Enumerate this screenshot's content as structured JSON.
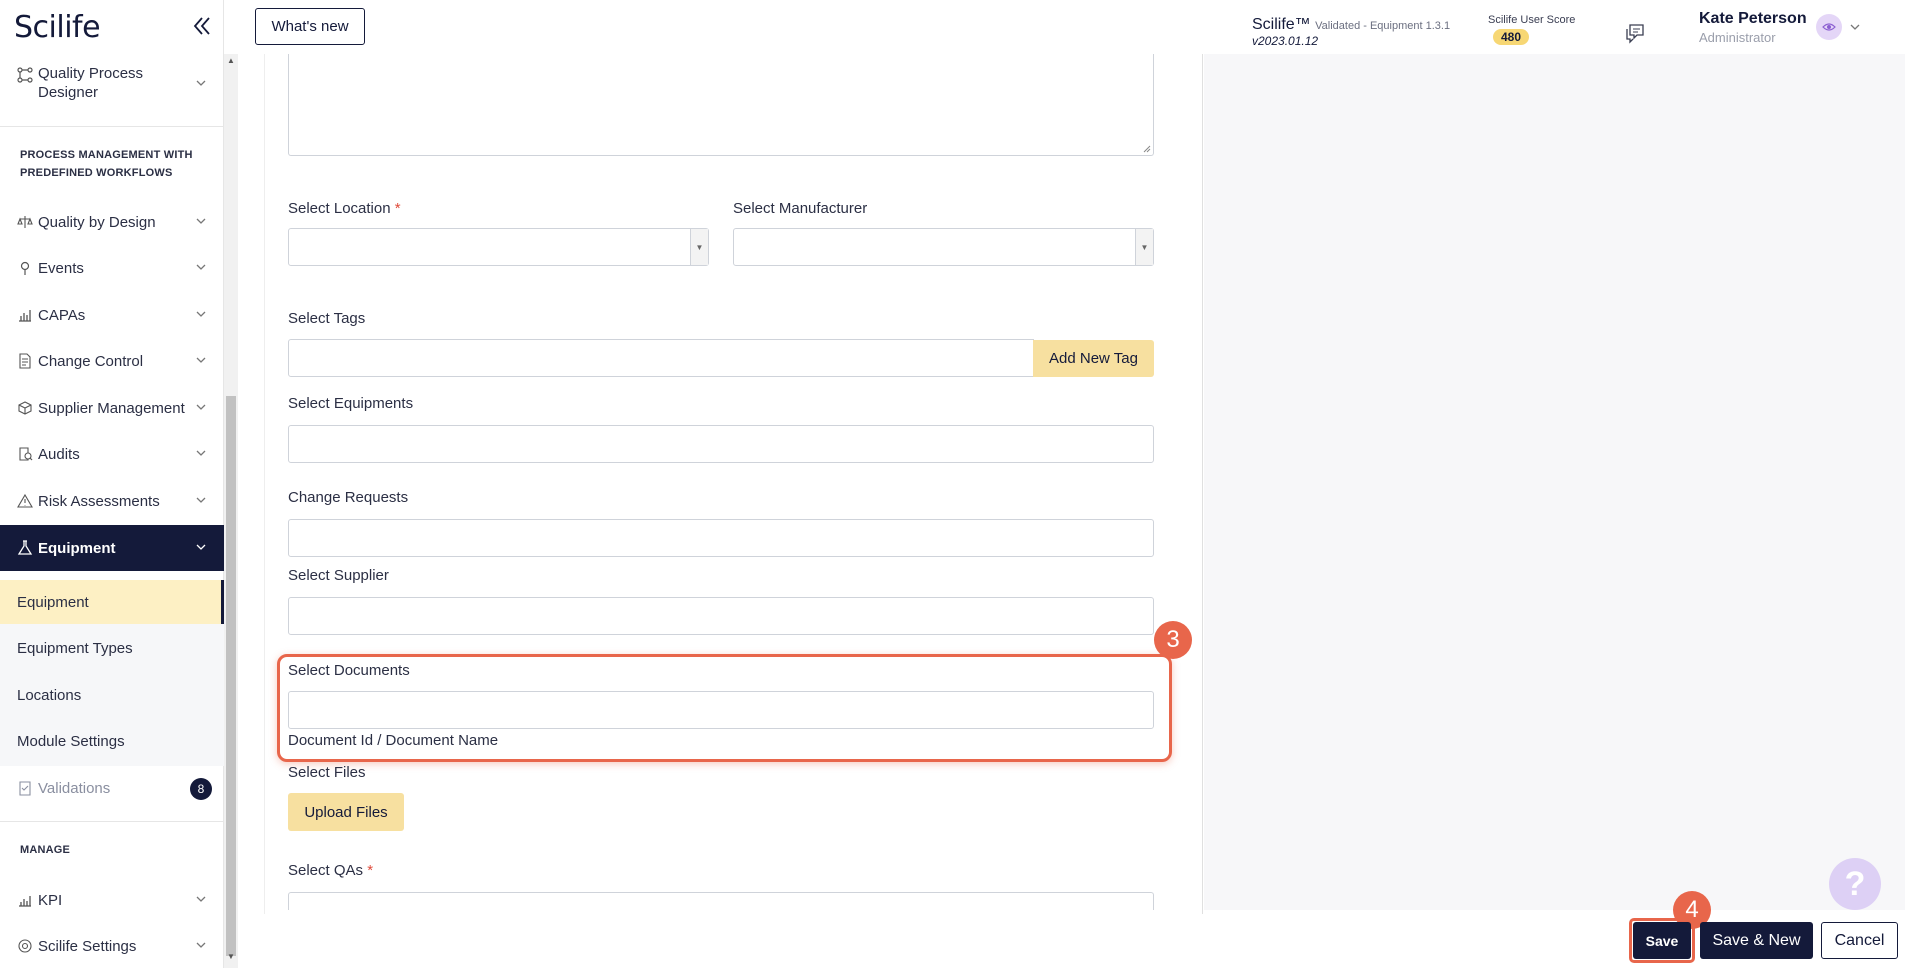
{
  "app": {
    "logo": "Scilife",
    "whats_new": "What's new",
    "product": "Scilife™",
    "validated": "Validated - Equipment 1.3.1",
    "version": "v2023.01.12",
    "score_label": "Scilife User Score",
    "score_value": "480",
    "user_name": "Kate Peterson",
    "user_role": "Administrator"
  },
  "sidebar": {
    "quality_process_designer_1": "Quality Process",
    "quality_process_designer_2": "Designer",
    "section_workflows_1": "PROCESS MANAGEMENT WITH",
    "section_workflows_2": "PREDEFINED WORKFLOWS",
    "items": [
      {
        "label": "Quality by Design",
        "icon": "scale-icon"
      },
      {
        "label": "Events",
        "icon": "pin-icon"
      },
      {
        "label": "CAPAs",
        "icon": "chart-icon"
      },
      {
        "label": "Change Control",
        "icon": "document-icon"
      },
      {
        "label": "Supplier Management",
        "icon": "box-icon"
      },
      {
        "label": "Audits",
        "icon": "clipboard-search-icon"
      },
      {
        "label": "Risk Assessments",
        "icon": "warning-icon"
      },
      {
        "label": "Equipment",
        "icon": "flask-icon"
      }
    ],
    "sub_items": [
      "Equipment",
      "Equipment Types",
      "Locations",
      "Module Settings"
    ],
    "validations": "Validations",
    "validations_count": "8",
    "section_manage": "MANAGE",
    "kpi": "KPI",
    "scilife_settings": "Scilife Settings"
  },
  "form": {
    "select_location": "Select Location",
    "select_manufacturer": "Select Manufacturer",
    "select_tags": "Select Tags",
    "add_new_tag": "Add New Tag",
    "select_equipments": "Select Equipments",
    "change_requests": "Change Requests",
    "select_supplier": "Select Supplier",
    "select_documents": "Select Documents",
    "documents_hint": "Document Id / Document Name",
    "select_files": "Select Files",
    "upload_files": "Upload Files",
    "select_qas": "Select QAs",
    "required_mark": "*"
  },
  "steps": {
    "documents": "3",
    "save": "4"
  },
  "footer": {
    "save": "Save",
    "save_new": "Save & New",
    "cancel": "Cancel"
  },
  "help": "?",
  "colors": {
    "brand_navy": "#141a3a",
    "accent_yellow": "#f7e0a0",
    "highlight": "#e8664b"
  }
}
